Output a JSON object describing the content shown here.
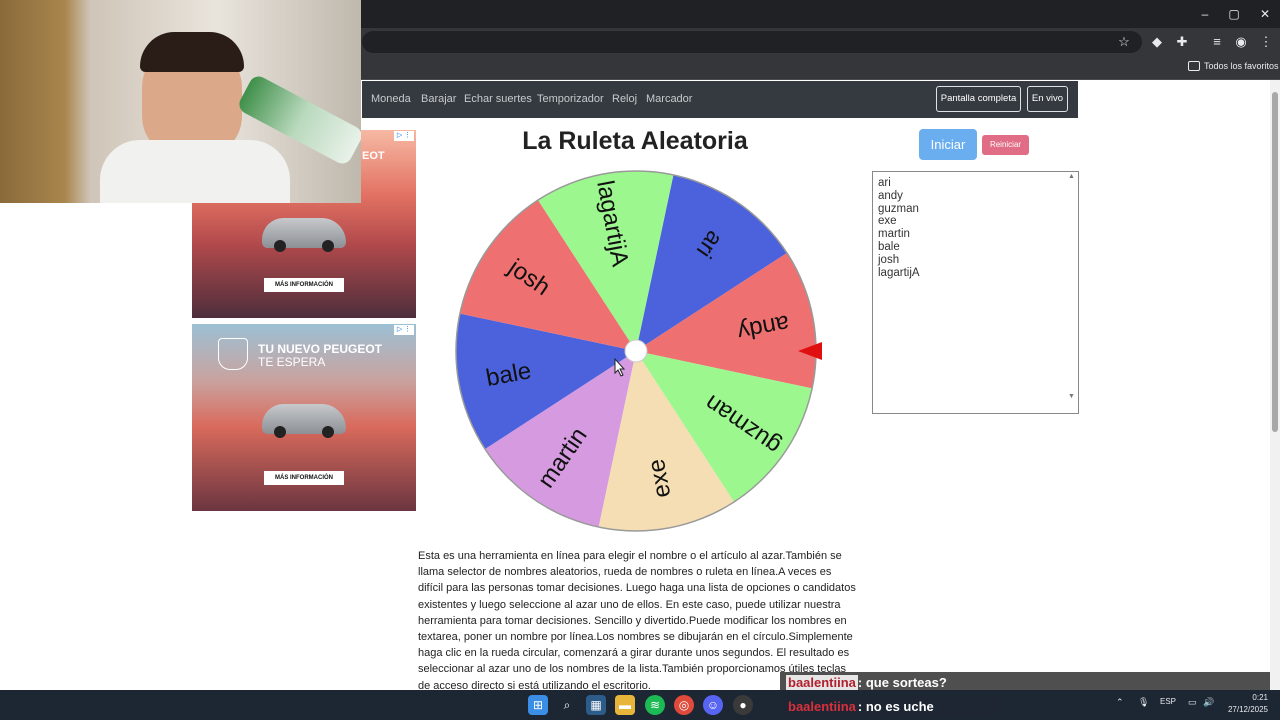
{
  "browser": {
    "window_controls": [
      "–",
      "▢",
      "✕"
    ],
    "bookmarks_folder": "Todos los favoritos"
  },
  "nav": {
    "links": [
      "Moneda",
      "Barajar",
      "Echar suertes",
      "Temporizador",
      "Reloj",
      "Marcador"
    ],
    "fullscreen": "Pantalla completa",
    "live": "En vivo"
  },
  "title": "La Ruleta Aleatoria",
  "buttons": {
    "start": "Iniciar",
    "reset": "Reiniciar"
  },
  "names_text": "ari\nandy\nguzman\nexe\nmartin\nbale\njosh\nlagartijA",
  "wheel": {
    "segments": [
      {
        "label": "ari",
        "color": "#4b62dc"
      },
      {
        "label": "andy",
        "color": "#ee7070"
      },
      {
        "label": "guzman",
        "color": "#9cf78e"
      },
      {
        "label": "exe",
        "color": "#f5deb3"
      },
      {
        "label": "martin",
        "color": "#d59ae0"
      },
      {
        "label": "bale",
        "color": "#4b62dc"
      },
      {
        "label": "josh",
        "color": "#ee7070"
      },
      {
        "label": "lagartijA",
        "color": "#9cf78e"
      }
    ],
    "pointer_color": "#e01010"
  },
  "description": "Esta es una herramienta en línea para elegir el nombre o el artículo al azar.También se llama selector de nombres aleatorios, rueda de nombres o ruleta en línea.A veces es difícil para las personas tomar decisiones. Luego haga una lista de opciones o candidatos existentes y luego seleccione al azar uno de ellos. En este caso, puede utilizar nuestra herramienta para tomar decisiones. Sencillo y divertido.Puede modificar los nombres en textarea, poner un nombre por línea.Los nombres se dibujarán en el círculo.Simplemente haga clic en la rueda circular, comenzará a girar durante unos segundos. El resultado es seleccionar al azar uno de los nombres de la lista.También proporcionamos útiles teclas de acceso directo si está utilizando el escritorio.",
  "ads": {
    "ad1": {
      "headline": "EOT",
      "cta": "MÁS INFORMACIÓN"
    },
    "ad2": {
      "headline_1": "TU NUEVO PEUGEOT",
      "headline_2": "TE ESPERA",
      "cta": "MÁS INFORMACIÓN"
    }
  },
  "chat": [
    {
      "user": "baalentiina",
      "message": ": que sorteas?"
    },
    {
      "user": "baalentiina",
      "message": ": no es uche"
    }
  ],
  "taskbar": {
    "lang": "ESP",
    "time": "0:21",
    "date": "27/12/2025"
  }
}
